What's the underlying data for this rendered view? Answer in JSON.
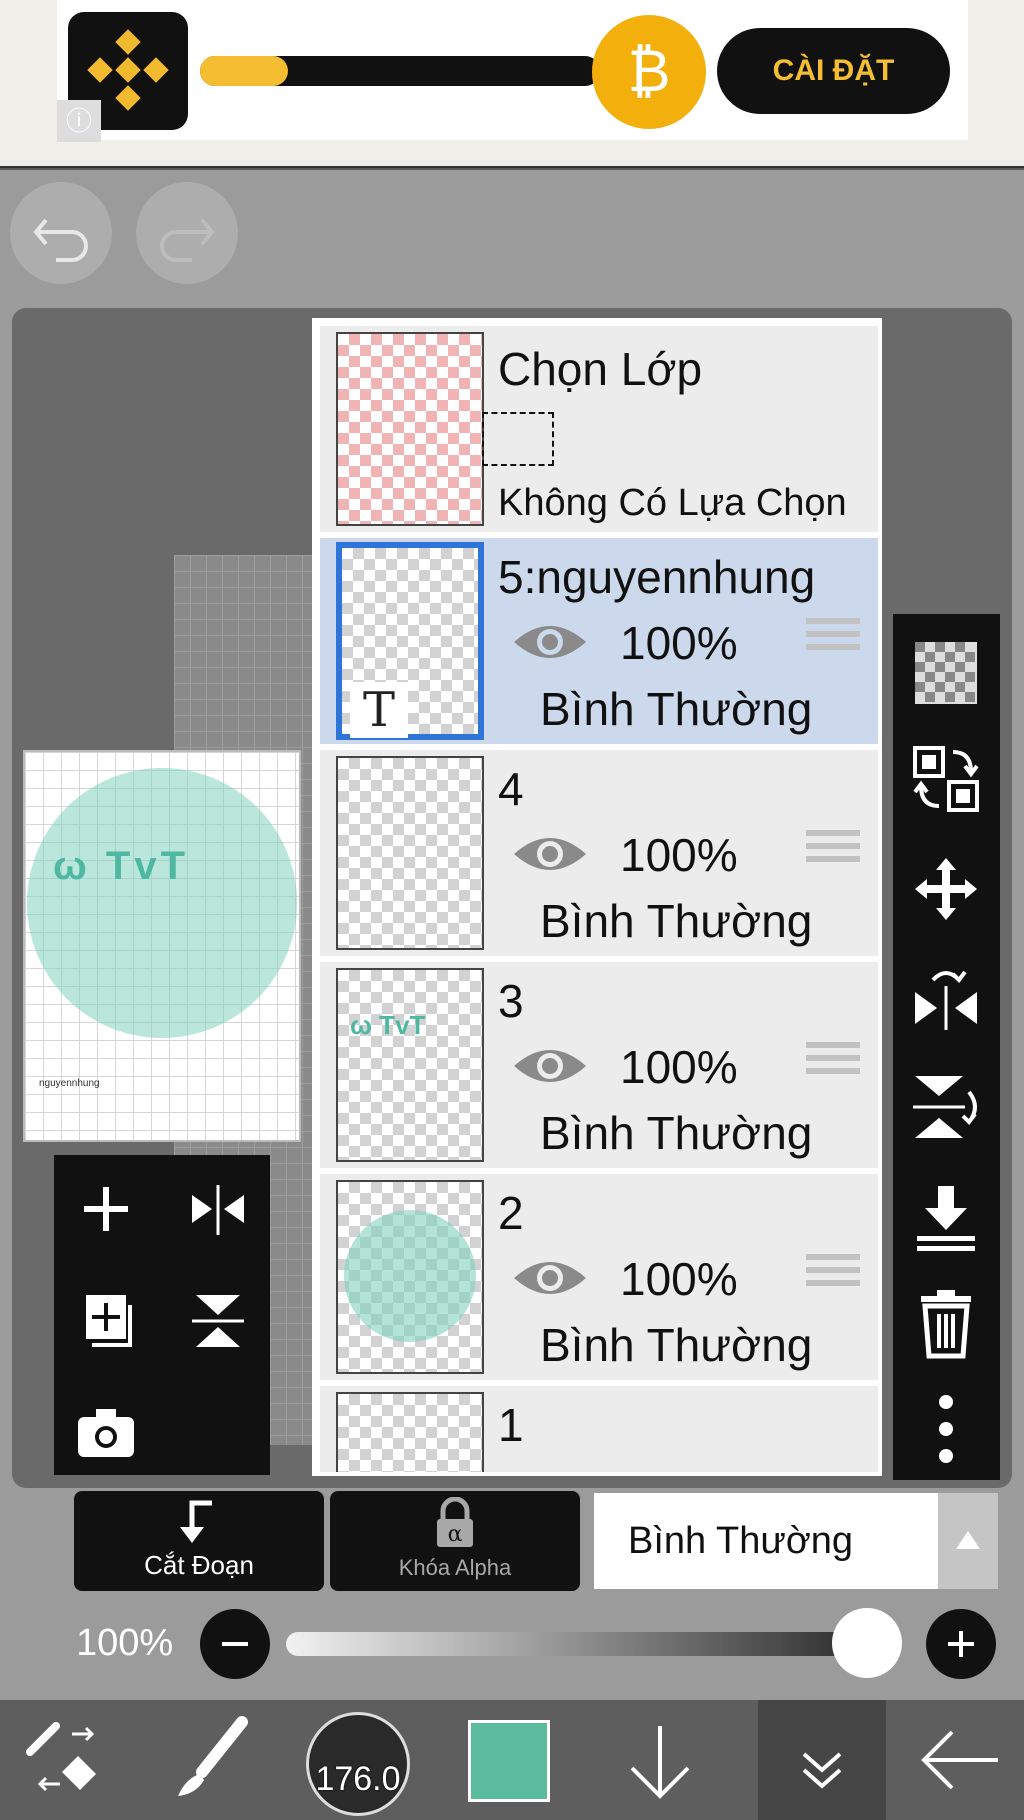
{
  "ad": {
    "install_label": "CÀI ĐẶT",
    "progress_fraction": 0.22,
    "info_icon": "info-icon",
    "coin_icon": "bitcoin-icon"
  },
  "toolbar": {
    "undo_icon": "undo-icon",
    "redo_icon": "redo-icon"
  },
  "preview": {
    "art_text": "ω TvT",
    "signature": "nguyennhung"
  },
  "layers_panel": {
    "selection": {
      "title": "Chọn Lớp",
      "subtitle": "Không Có Lựa Chọn"
    },
    "layers": [
      {
        "name": "5:nguyennhung",
        "opacity": "100%",
        "mode": "Bình Thường",
        "selected": true,
        "thumb_text": "T"
      },
      {
        "name": "4",
        "opacity": "100%",
        "mode": "Bình Thường",
        "selected": false
      },
      {
        "name": "3",
        "opacity": "100%",
        "mode": "Bình Thường",
        "selected": false,
        "thumb_text": "ω TvT"
      },
      {
        "name": "2",
        "opacity": "100%",
        "mode": "Bình Thường",
        "selected": false
      },
      {
        "name": "1",
        "selected": false
      }
    ]
  },
  "tool_strip": [
    "checker-icon",
    "swap-layer-icon",
    "move-icon",
    "flip-horizontal-icon",
    "flip-vertical-icon",
    "merge-down-icon",
    "trash-icon",
    "more-icon"
  ],
  "bottom_controls": {
    "clip_label": "Cắt Đoạn",
    "alpha_label": "Khóa Alpha",
    "blend_mode": "Bình Thường",
    "opacity_label": "100%",
    "opacity_value": 1.0
  },
  "bottom_nav": {
    "brush_size": "176.0",
    "color": "#5dbb9d"
  }
}
